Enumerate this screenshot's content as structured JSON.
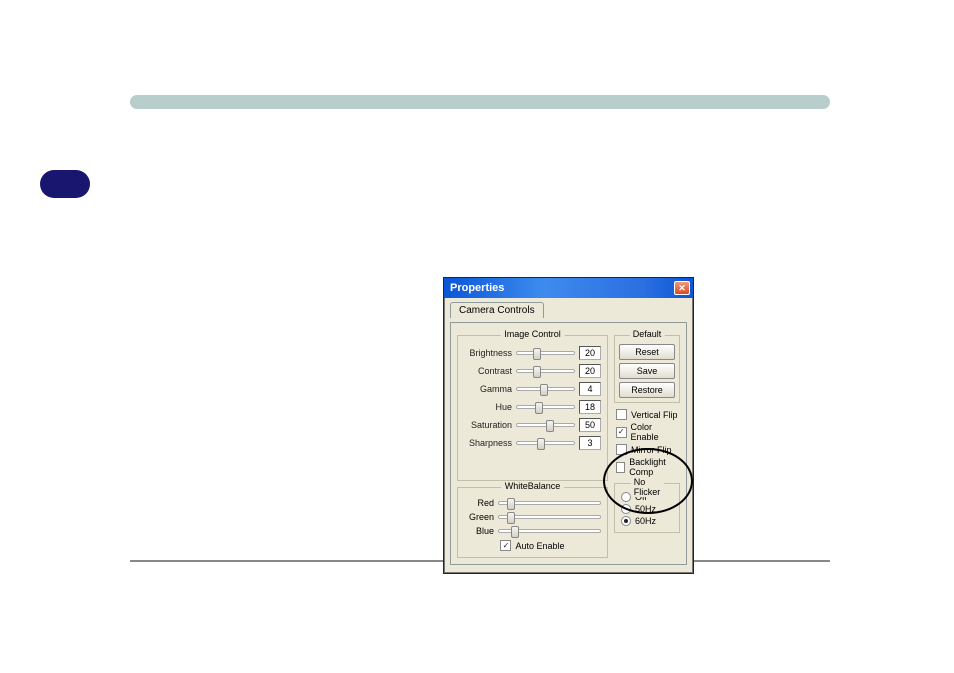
{
  "window": {
    "title": "Properties",
    "tabs": {
      "camera_controls": "Camera Controls"
    }
  },
  "image_control": {
    "legend": "Image Control",
    "brightness": {
      "label": "Brightness",
      "value": "20",
      "pct": 28
    },
    "contrast": {
      "label": "Contrast",
      "value": "20",
      "pct": 28
    },
    "gamma": {
      "label": "Gamma",
      "value": "4",
      "pct": 40
    },
    "hue": {
      "label": "Hue",
      "value": "18",
      "pct": 32
    },
    "saturation": {
      "label": "Saturation",
      "value": "50",
      "pct": 50
    },
    "sharpness": {
      "label": "Sharpness",
      "value": "3",
      "pct": 35
    }
  },
  "default": {
    "legend": "Default",
    "reset": "Reset",
    "save": "Save",
    "restore": "Restore"
  },
  "checks": {
    "vertical_flip": {
      "label": "Vertical Flip",
      "checked": false
    },
    "color_enable": {
      "label": "Color Enable",
      "checked": true
    },
    "mirror_flip": {
      "label": "Mirror Flip",
      "checked": false
    },
    "backlight_comp": {
      "label": "Backlight Comp",
      "checked": false
    }
  },
  "no_flicker": {
    "legend": "No Flicker",
    "off": {
      "label": "Off",
      "selected": false
    },
    "f50": {
      "label": "50Hz",
      "selected": false
    },
    "f60": {
      "label": "60Hz",
      "selected": true
    }
  },
  "white_balance": {
    "legend": "WhiteBalance",
    "red": {
      "label": "Red",
      "pct": 8
    },
    "green": {
      "label": "Green",
      "pct": 8
    },
    "blue": {
      "label": "Blue",
      "pct": 12
    },
    "auto_enable": {
      "label": "Auto Enable",
      "checked": true
    }
  }
}
